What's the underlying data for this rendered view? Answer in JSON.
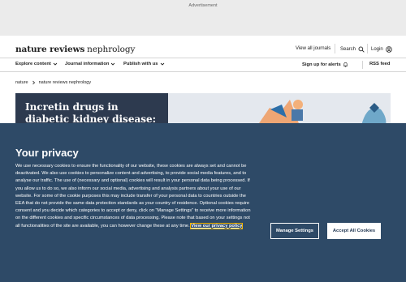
{
  "ad": {
    "label": "Advertisement"
  },
  "header": {
    "logo_bold": "nature reviews",
    "logo_rest": "nephrology",
    "view_all_journals": "View all journals",
    "search": "Search",
    "login": "Login"
  },
  "nav": {
    "items": [
      "Explore content",
      "Journal information",
      "Publish with us"
    ],
    "sign_up": "Sign up for alerts",
    "rss": "RSS feed"
  },
  "breadcrumb": {
    "items": [
      "nature",
      "nature reviews nephrology"
    ]
  },
  "banner": {
    "title": "Incretin drugs in diabetic kidney disease: biological"
  },
  "cookie": {
    "title": "Your privacy",
    "body": "We use necessary cookies to ensure the functionality of our website, these cookies are always set and cannot be deactivated. We also use cookies to personalize content and advertising, to provide social media features, and to analyse our traffic. The use of (necessary and optional) cookies will result in your personal data being processed. If you allow us to do so, we also inform our social media, advertising and analysis partners about your use of our website. For some of the cookie purposes this may include transfer of your personal data to countries outside the EEA that do not provide the same data protection standards as your country of residence. Optional cookies require consent and you decide which categories to accept or deny, click on “Manage Settings” to receive more information on the different cookies and specific circumstances of data processing. Please note that based on your settings not all functionalities of the site are available, you can however change these at any time.",
    "policy_link": "View our privacy policy",
    "manage_settings": "Manage Settings",
    "accept_all": "Accept All Cookies"
  },
  "icons": {
    "search": "search-icon",
    "login": "user-icon",
    "alerts": "bell-icon",
    "chevron": "chevron-down-icon",
    "crumb": "chevron-right-icon"
  },
  "colors": {
    "cookie_bg": "#2e4a67",
    "focus_outline": "#f2b400",
    "banner_bg": "#2d3a4f"
  }
}
